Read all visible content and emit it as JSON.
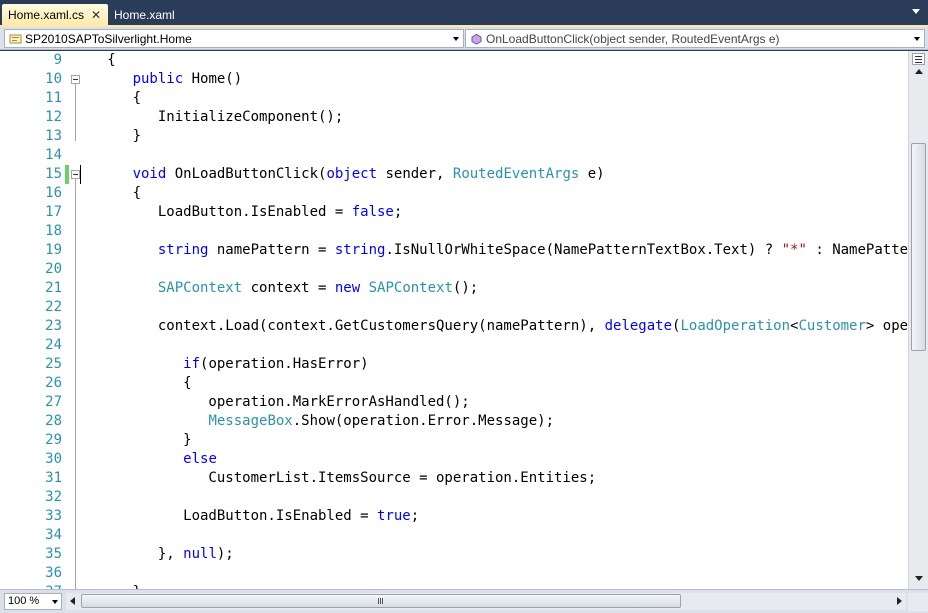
{
  "tabs": [
    {
      "label": "Home.xaml.cs",
      "active": true
    },
    {
      "label": "Home.xaml",
      "active": false
    }
  ],
  "navbar": {
    "type_combo": "SP2010SAPToSilverlight.Home",
    "member_combo": "OnLoadButtonClick(object sender, RoutedEventArgs e)"
  },
  "zoom": "100 %",
  "code_lines": [
    {
      "n": "9",
      "tokens": [
        [
          "p",
          "   {"
        ]
      ]
    },
    {
      "n": "10",
      "tokens": [
        [
          "p",
          "      "
        ],
        [
          "k",
          "public"
        ],
        [
          "p",
          " Home()"
        ]
      ]
    },
    {
      "n": "11",
      "tokens": [
        [
          "p",
          "      {"
        ]
      ]
    },
    {
      "n": "12",
      "tokens": [
        [
          "p",
          "         InitializeComponent();"
        ]
      ]
    },
    {
      "n": "13",
      "tokens": [
        [
          "p",
          "      }"
        ]
      ]
    },
    {
      "n": "14",
      "tokens": [
        [
          "p",
          ""
        ]
      ]
    },
    {
      "n": "15",
      "tokens": [
        [
          "p",
          "      "
        ],
        [
          "k",
          "void"
        ],
        [
          "p",
          " OnLoadButtonClick("
        ],
        [
          "k",
          "object"
        ],
        [
          "p",
          " sender, "
        ],
        [
          "t",
          "RoutedEventArgs"
        ],
        [
          "p",
          " e)"
        ]
      ]
    },
    {
      "n": "16",
      "tokens": [
        [
          "p",
          "      {"
        ]
      ]
    },
    {
      "n": "17",
      "tokens": [
        [
          "p",
          "         LoadButton.IsEnabled = "
        ],
        [
          "k",
          "false"
        ],
        [
          "p",
          ";"
        ]
      ]
    },
    {
      "n": "18",
      "tokens": [
        [
          "p",
          ""
        ]
      ]
    },
    {
      "n": "19",
      "tokens": [
        [
          "p",
          "         "
        ],
        [
          "k",
          "string"
        ],
        [
          "p",
          " namePattern = "
        ],
        [
          "k",
          "string"
        ],
        [
          "p",
          ".IsNullOrWhiteSpace(NamePatternTextBox.Text) ? "
        ],
        [
          "s",
          "\"*\""
        ],
        [
          "p",
          " : NamePatternTextBox.Text;"
        ]
      ]
    },
    {
      "n": "20",
      "tokens": [
        [
          "p",
          ""
        ]
      ]
    },
    {
      "n": "21",
      "tokens": [
        [
          "p",
          "         "
        ],
        [
          "t",
          "SAPContext"
        ],
        [
          "p",
          " context = "
        ],
        [
          "k",
          "new"
        ],
        [
          "p",
          " "
        ],
        [
          "t",
          "SAPContext"
        ],
        [
          "p",
          "();"
        ]
      ]
    },
    {
      "n": "22",
      "tokens": [
        [
          "p",
          ""
        ]
      ]
    },
    {
      "n": "23",
      "tokens": [
        [
          "p",
          "         context.Load(context.GetCustomersQuery(namePattern), "
        ],
        [
          "k",
          "delegate"
        ],
        [
          "p",
          "("
        ],
        [
          "t",
          "LoadOperation"
        ],
        [
          "p",
          "<"
        ],
        [
          "t",
          "Customer"
        ],
        [
          "p",
          "> operation)"
        ]
      ]
    },
    {
      "n": "24",
      "tokens": [
        [
          "p",
          ""
        ]
      ]
    },
    {
      "n": "25",
      "tokens": [
        [
          "p",
          "            "
        ],
        [
          "k",
          "if"
        ],
        [
          "p",
          "(operation.HasError)"
        ]
      ]
    },
    {
      "n": "26",
      "tokens": [
        [
          "p",
          "            {"
        ]
      ]
    },
    {
      "n": "27",
      "tokens": [
        [
          "p",
          "               operation.MarkErrorAsHandled();"
        ]
      ]
    },
    {
      "n": "28",
      "tokens": [
        [
          "p",
          "               "
        ],
        [
          "t",
          "MessageBox"
        ],
        [
          "p",
          ".Show(operation.Error.Message);"
        ]
      ]
    },
    {
      "n": "29",
      "tokens": [
        [
          "p",
          "            }"
        ]
      ]
    },
    {
      "n": "30",
      "tokens": [
        [
          "p",
          "            "
        ],
        [
          "k",
          "else"
        ]
      ]
    },
    {
      "n": "31",
      "tokens": [
        [
          "p",
          "               CustomerList.ItemsSource = operation.Entities;"
        ]
      ]
    },
    {
      "n": "32",
      "tokens": [
        [
          "p",
          ""
        ]
      ]
    },
    {
      "n": "33",
      "tokens": [
        [
          "p",
          "            LoadButton.IsEnabled = "
        ],
        [
          "k",
          "true"
        ],
        [
          "p",
          ";"
        ]
      ]
    },
    {
      "n": "34",
      "tokens": [
        [
          "p",
          ""
        ]
      ]
    },
    {
      "n": "35",
      "tokens": [
        [
          "p",
          "         }, "
        ],
        [
          "k",
          "null"
        ],
        [
          "p",
          ");"
        ]
      ]
    },
    {
      "n": "36",
      "tokens": [
        [
          "p",
          ""
        ]
      ]
    },
    {
      "n": "37",
      "tokens": [
        [
          "p",
          "      }"
        ]
      ]
    }
  ],
  "colors": {
    "keyword": "#0000ff",
    "type": "#2b91af",
    "string": "#a31515",
    "line_number": "#2b91af",
    "changed_line": "#6ccf6c",
    "active_tab": "#ffe8a6",
    "window_bg": "#2b3c59"
  },
  "icons": [
    "close-icon",
    "class-icon",
    "method-icon",
    "chevron-down-icon",
    "splitter-icon"
  ]
}
